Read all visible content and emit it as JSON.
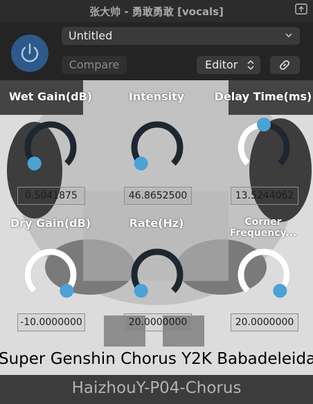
{
  "window": {
    "title": "张大帅 - 勇敢勇敢 [vocals]"
  },
  "host": {
    "preset": "Untitled",
    "compare_label": "Compare",
    "editor_label": "Editor"
  },
  "plugin": {
    "knobs": [
      {
        "label": "Wet Gain(dB)",
        "value": "0.5041875",
        "level": 0.0
      },
      {
        "label": "Intensity",
        "value": "46.8652500",
        "level": 0.0
      },
      {
        "label": "Delay Time(ms)",
        "value": "13.5244062",
        "level": 0.5
      },
      {
        "label": "Dry Gain(dB)",
        "value": "-10.0000000",
        "level": 1.0
      },
      {
        "label": "Rate(Hz)",
        "value": "20.0000000",
        "level": 0.0
      },
      {
        "label": "Corner Frequency...",
        "value": "20.0000000",
        "level": 1.0
      }
    ],
    "banner": "Super Genshin Chorus Y2K Babadeleida"
  },
  "footer": {
    "name": "HaizhouY-P04-Chorus"
  },
  "colors": {
    "accent": "#4ba3d4",
    "track": "#1e2730",
    "fill": "#ffffff",
    "power": "#2d5a88"
  }
}
